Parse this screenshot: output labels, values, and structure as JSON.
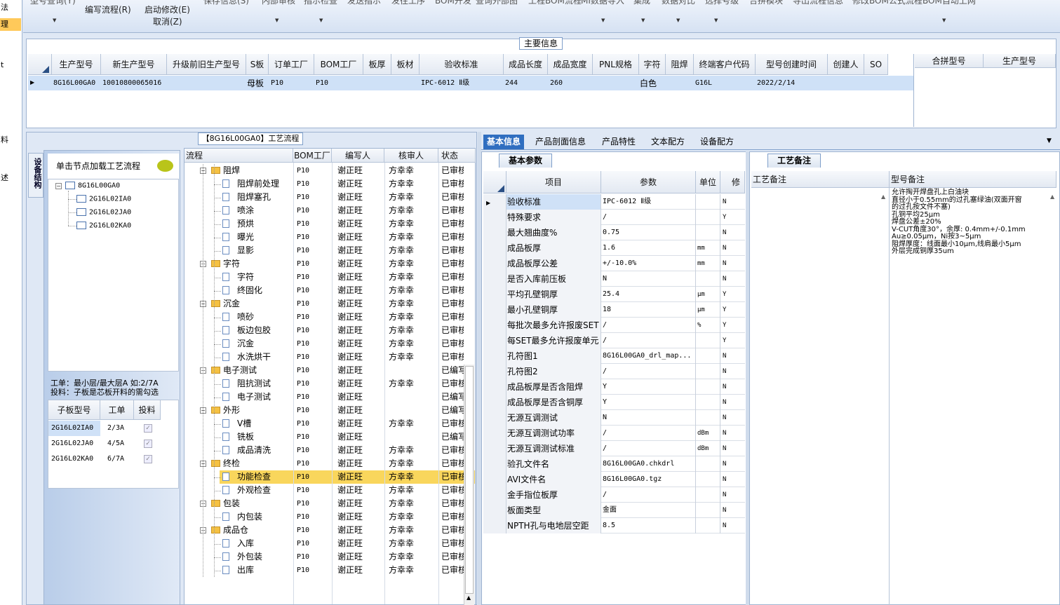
{
  "left_strip": {
    "items": [
      "法",
      "理",
      "t",
      "料",
      "述"
    ]
  },
  "toolbar": {
    "row1": [
      "型号查询(Y)",
      "编写流程(R)",
      "启动修改(E)",
      "保存信息(S)",
      "内部审核",
      "指示检查",
      "发送指示",
      "发往工序",
      "BOM开发",
      "查询外部图",
      "工程BOM流程",
      "MI数据导入",
      "集成",
      "数据对比",
      "选择号级",
      "合拼模块",
      "导出流程信息",
      "修改BOM公式流程",
      "BOM自动上网"
    ],
    "cancel": "取消(Z)"
  },
  "main_info": {
    "title": "主要信息",
    "columns": [
      "生产型号",
      "新生产型号",
      "升级前旧生产型号",
      "S板",
      "订单工厂",
      "BOM工厂",
      "板厚",
      "板材",
      "验收标准",
      "成品长度",
      "成品宽度",
      "PNL规格",
      "字符",
      "阻焊",
      "终端客户代码",
      "型号创建时间",
      "创建人",
      "SO"
    ],
    "row": {
      "model": "8G16L00GA0",
      "new_model": "10010800065016",
      "old_model": "",
      "s_board": "母板",
      "order_factory": "P10",
      "bom_factory": "P10",
      "thickness": "",
      "material": "",
      "standard": "IPC-6012 Ⅱ级",
      "length": "244",
      "width": "260",
      "pnl": "",
      "char": "白色",
      "solder": "",
      "customer": "G16L",
      "created": "2022/2/14",
      "creator": "",
      "so": ""
    },
    "merge_columns": [
      "合拼型号",
      "生产型号"
    ]
  },
  "flow": {
    "title": "【8G16L00GA0】工艺流程",
    "side_tab": "设备结构",
    "node_header": "单击节点加载工艺流程",
    "tree": [
      "8G16L00GA0",
      "2G16L02IA0",
      "2G16L02JA0",
      "2G16L02KA0"
    ],
    "info": [
      "工单：最小层/最大层A 如:2/7A",
      "投料：子板是芯板开料的需勾选"
    ],
    "sub_columns": [
      "子板型号",
      "工单",
      "投料"
    ],
    "sub_rows": [
      {
        "model": "2G16L02IA0",
        "order": "2/3A"
      },
      {
        "model": "2G16L02JA0",
        "order": "4/5A"
      },
      {
        "model": "2G16L02KA0",
        "order": "6/7A"
      }
    ],
    "grid_columns": [
      "流程",
      "BOM工厂",
      "编写人",
      "核审人",
      "状态"
    ],
    "rows": [
      {
        "name": "阻焊",
        "type": "group",
        "bom": "P10",
        "writer": "谢正旺",
        "checker": "方幸幸",
        "status": "已审核"
      },
      {
        "name": "阻焊前处理",
        "type": "item",
        "bom": "P10",
        "writer": "谢正旺",
        "checker": "方幸幸",
        "status": "已审核"
      },
      {
        "name": "阻焊塞孔",
        "type": "item",
        "bom": "P10",
        "writer": "谢正旺",
        "checker": "方幸幸",
        "status": "已审核"
      },
      {
        "name": "喷涂",
        "type": "item",
        "bom": "P10",
        "writer": "谢正旺",
        "checker": "方幸幸",
        "status": "已审核"
      },
      {
        "name": "预烘",
        "type": "item",
        "bom": "P10",
        "writer": "谢正旺",
        "checker": "方幸幸",
        "status": "已审核"
      },
      {
        "name": "曝光",
        "type": "item",
        "bom": "P10",
        "writer": "谢正旺",
        "checker": "方幸幸",
        "status": "已审核"
      },
      {
        "name": "显影",
        "type": "item",
        "bom": "P10",
        "writer": "谢正旺",
        "checker": "方幸幸",
        "status": "已审核"
      },
      {
        "name": "字符",
        "type": "group",
        "bom": "P10",
        "writer": "谢正旺",
        "checker": "方幸幸",
        "status": "已审核"
      },
      {
        "name": "字符",
        "type": "item",
        "bom": "P10",
        "writer": "谢正旺",
        "checker": "方幸幸",
        "status": "已审核"
      },
      {
        "name": "终固化",
        "type": "item",
        "bom": "P10",
        "writer": "谢正旺",
        "checker": "方幸幸",
        "status": "已审核"
      },
      {
        "name": "沉金",
        "type": "group",
        "bom": "P10",
        "writer": "谢正旺",
        "checker": "方幸幸",
        "status": "已审核"
      },
      {
        "name": "喷砂",
        "type": "item",
        "bom": "P10",
        "writer": "谢正旺",
        "checker": "方幸幸",
        "status": "已审核"
      },
      {
        "name": "板边包胶",
        "type": "item",
        "bom": "P10",
        "writer": "谢正旺",
        "checker": "方幸幸",
        "status": "已审核"
      },
      {
        "name": "沉金",
        "type": "item",
        "bom": "P10",
        "writer": "谢正旺",
        "checker": "方幸幸",
        "status": "已审核"
      },
      {
        "name": "水洗烘干",
        "type": "item",
        "bom": "P10",
        "writer": "谢正旺",
        "checker": "方幸幸",
        "status": "已审核"
      },
      {
        "name": "电子测试",
        "type": "group",
        "bom": "P10",
        "writer": "谢正旺",
        "checker": "",
        "status": "已编写"
      },
      {
        "name": "阻抗测试",
        "type": "item",
        "bom": "P10",
        "writer": "谢正旺",
        "checker": "方幸幸",
        "status": "已审核"
      },
      {
        "name": "电子测试",
        "type": "item",
        "bom": "P10",
        "writer": "谢正旺",
        "checker": "",
        "status": "已编写"
      },
      {
        "name": "外形",
        "type": "group",
        "bom": "P10",
        "writer": "谢正旺",
        "checker": "",
        "status": "已编写"
      },
      {
        "name": "V槽",
        "type": "item",
        "bom": "P10",
        "writer": "谢正旺",
        "checker": "方幸幸",
        "status": "已审核"
      },
      {
        "name": "铣板",
        "type": "item",
        "bom": "P10",
        "writer": "谢正旺",
        "checker": "",
        "status": "已编写"
      },
      {
        "name": "成品清洗",
        "type": "item",
        "bom": "P10",
        "writer": "谢正旺",
        "checker": "方幸幸",
        "status": "已审核"
      },
      {
        "name": "终检",
        "type": "group",
        "bom": "P10",
        "writer": "谢正旺",
        "checker": "方幸幸",
        "status": "已审核"
      },
      {
        "name": "功能检查",
        "type": "item",
        "bom": "P10",
        "writer": "谢正旺",
        "checker": "方幸幸",
        "status": "已审核",
        "selected": true
      },
      {
        "name": "外观检查",
        "type": "item",
        "bom": "P10",
        "writer": "谢正旺",
        "checker": "方幸幸",
        "status": "已审核"
      },
      {
        "name": "包装",
        "type": "group",
        "bom": "P10",
        "writer": "谢正旺",
        "checker": "方幸幸",
        "status": "已审核"
      },
      {
        "name": "内包装",
        "type": "item",
        "bom": "P10",
        "writer": "谢正旺",
        "checker": "方幸幸",
        "status": "已审核"
      },
      {
        "name": "成品仓",
        "type": "group",
        "bom": "P10",
        "writer": "谢正旺",
        "checker": "方幸幸",
        "status": "已审核"
      },
      {
        "name": "入库",
        "type": "item",
        "bom": "P10",
        "writer": "谢正旺",
        "checker": "方幸幸",
        "status": "已审核"
      },
      {
        "name": "外包装",
        "type": "item",
        "bom": "P10",
        "writer": "谢正旺",
        "checker": "方幸幸",
        "status": "已审核"
      },
      {
        "name": "出库",
        "type": "item",
        "bom": "P10",
        "writer": "谢正旺",
        "checker": "方幸幸",
        "status": "已审核"
      }
    ]
  },
  "right_tabs": [
    "基本信息",
    "产品剖面信息",
    "产品特性",
    "文本配方",
    "设备配方"
  ],
  "basic": {
    "title": "基本参数",
    "columns": [
      "项目",
      "参数",
      "单位",
      "修改"
    ],
    "rows": [
      {
        "item": "验收标准",
        "value": "IPC-6012 Ⅱ级",
        "unit": "",
        "mod": "N"
      },
      {
        "item": "特殊要求",
        "value": "/",
        "unit": "",
        "mod": "Y"
      },
      {
        "item": "最大翘曲度%",
        "value": "0.75",
        "unit": "",
        "mod": "N"
      },
      {
        "item": "成品板厚",
        "value": "1.6",
        "unit": "mm",
        "mod": "N"
      },
      {
        "item": "成品板厚公差",
        "value": "+/-10.0%",
        "unit": "mm",
        "mod": "N"
      },
      {
        "item": "是否入库前压板",
        "value": "N",
        "unit": "",
        "mod": "N"
      },
      {
        "item": "平均孔壁铜厚",
        "value": "25.4",
        "unit": "μm",
        "mod": "Y"
      },
      {
        "item": "最小孔壁铜厚",
        "value": "18",
        "unit": "μm",
        "mod": "Y"
      },
      {
        "item": "每批次最多允许报废SET",
        "value": "/",
        "unit": "%",
        "mod": "Y"
      },
      {
        "item": "每SET最多允许报废单元",
        "value": "/",
        "unit": "",
        "mod": "Y"
      },
      {
        "item": "孔符图1",
        "value": "8G16L00GA0_drl_map...",
        "unit": "",
        "mod": "N"
      },
      {
        "item": "孔符图2",
        "value": "/",
        "unit": "",
        "mod": "N"
      },
      {
        "item": "成品板厚是否含阻焊",
        "value": "Y",
        "unit": "",
        "mod": "N"
      },
      {
        "item": "成品板厚是否含铜厚",
        "value": "Y",
        "unit": "",
        "mod": "N"
      },
      {
        "item": "无源互调测试",
        "value": "N",
        "unit": "",
        "mod": "N"
      },
      {
        "item": "无源互调测试功率",
        "value": "/",
        "unit": "dBm",
        "mod": "N"
      },
      {
        "item": "无源互调测试标准",
        "value": "/",
        "unit": "dBm",
        "mod": "N"
      },
      {
        "item": "验孔文件名",
        "value": "8G16L00GA0.chkdrl",
        "unit": "",
        "mod": "N"
      },
      {
        "item": "AVI文件名",
        "value": "8G16L00GA0.tgz",
        "unit": "",
        "mod": "N"
      },
      {
        "item": "金手指位板厚",
        "value": "/",
        "unit": "",
        "mod": "N"
      },
      {
        "item": "板面类型",
        "value": "金面",
        "unit": "",
        "mod": "N"
      },
      {
        "item": "NPTH孔与电地层空距",
        "value": "8.5",
        "unit": "",
        "mod": "N"
      }
    ]
  },
  "craft": {
    "title": "工艺备注",
    "col1": "工艺备注",
    "col2": "型号备注",
    "note_lines": [
      "允许掏开焊盘孔上白油块",
      "直径小于0.55mm的过孔塞绿油(双面开窗",
      "的过孔按文件不塞)",
      "孔铜平均25μm",
      "焊盘公差±20%",
      "V-CUT角度30°，余厚: 0.4mm+/-0.1mm",
      "Au≥0.05μm，Ni按3~5μm",
      "阻焊厚度：线面最小10μm,线肩最小5μm",
      "外层完成铜厚35um"
    ]
  }
}
